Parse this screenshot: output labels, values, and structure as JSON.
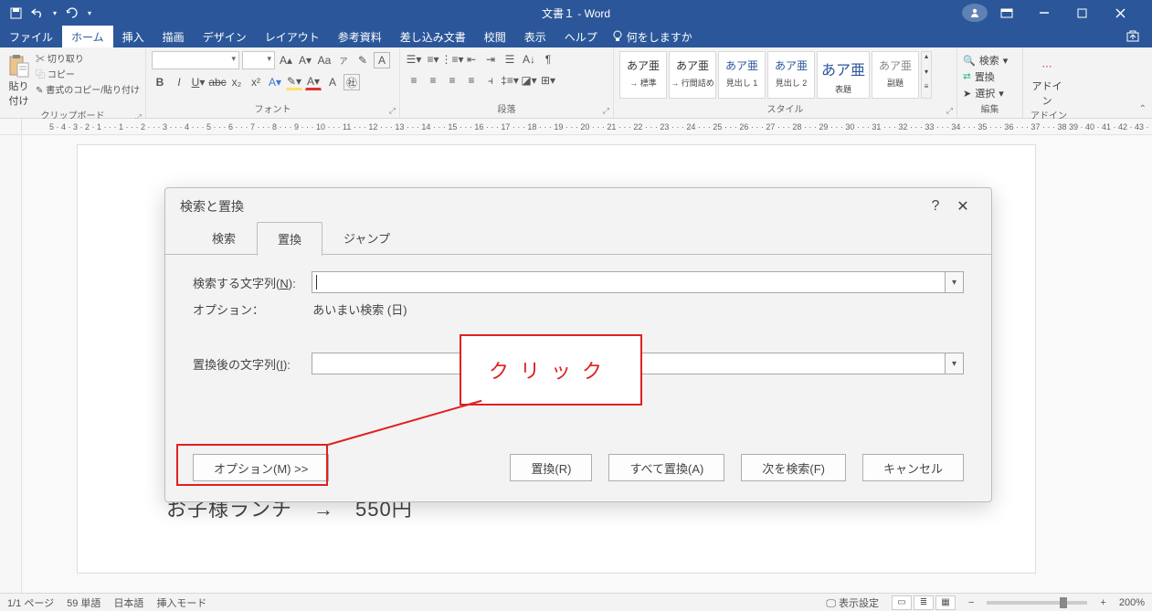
{
  "titlebar": {
    "title": "文書１ - Word"
  },
  "tabs": {
    "items": [
      "ファイル",
      "ホーム",
      "挿入",
      "描画",
      "デザイン",
      "レイアウト",
      "参考資料",
      "差し込み文書",
      "校閲",
      "表示",
      "ヘルプ"
    ],
    "active_index": 1,
    "tellme": "何をしますか"
  },
  "ribbon": {
    "clipboard": {
      "paste": "貼り付け",
      "cut": "切り取り",
      "copy": "コピー",
      "fmt": "書式のコピー/貼り付け",
      "label": "クリップボード"
    },
    "font": {
      "name": "",
      "size": "",
      "label": "フォント"
    },
    "para": {
      "label": "段落"
    },
    "styles": {
      "items": [
        {
          "sample": "あア亜",
          "name": "→ 標準"
        },
        {
          "sample": "あア亜",
          "name": "→ 行間詰め"
        },
        {
          "sample": "あア亜",
          "name": "見出し 1"
        },
        {
          "sample": "あア亜",
          "name": "見出し 2"
        },
        {
          "sample": "あア亜",
          "name": "表題"
        },
        {
          "sample": "あア亜",
          "name": "副題"
        }
      ],
      "label": "スタイル"
    },
    "editing": {
      "find": "検索",
      "replace": "置換",
      "select": "選択",
      "label": "編集"
    },
    "addin": {
      "label": "アドイン",
      "btn": "アドイン"
    }
  },
  "ruler": "5  ·  4  ·  3  ·  2  ·  1  ·  ·  ·  1  ·  ·  ·  2  ·  ·  ·  3  ·  ·  ·  4  ·  ·  ·  5  ·  ·  ·  6  ·  ·  ·  7  ·  ·  ·  8  ·  ·  ·  9  ·  ·  · 10 ·  ·  · 11 ·  ·  · 12 ·  ·  · 13 ·  ·  · 14 ·  ·  · 15 ·  ·  · 16 ·  ·  · 17 ·  ·  · 18 ·  ·  · 19 ·  ·  · 20 ·  ·  · 21 ·  ·  · 22 ·  ·  · 23 ·  ·  · 24 ·  ·  · 25 ·  ·  · 26 ·  ·  · 27 ·  ·  · 28 ·  ·  · 29 ·  ·  · 30 ·  ·  · 31 ·  ·  · 32 ·  ·  · 33 ·  ·  · 34 ·  ·  · 35 ·  ·  · 36 ·  ·  · 37 ·  ·  · 38   39 · 40 · 41 · 42 · 43 ·",
  "dialog": {
    "title": "検索と置換",
    "tabs": [
      "検索",
      "置換",
      "ジャンプ"
    ],
    "active_tab": 1,
    "find_label": "検索する文字列(",
    "find_u": "N",
    "find_label2": "):",
    "options_label": "オプション：",
    "options_value": "あいまい検索 (日)",
    "replace_label": "置換後の文字列(",
    "replace_u": "I",
    "replace_label2": "):",
    "more_btn": "オプション(M) >>",
    "replace_btn": "置換(R)",
    "replace_all_btn": "すべて置換(A)",
    "find_next_btn": "次を検索(F)",
    "cancel_btn": "キャンセル"
  },
  "annotation": {
    "click": "クリック"
  },
  "fragment": "お子様ランチ　→　550円",
  "statusbar": {
    "page": "1/1 ページ",
    "words": "59 単語",
    "lang": "日本語",
    "mode": "挿入モード",
    "display": "表示設定",
    "zoom": "200%"
  }
}
